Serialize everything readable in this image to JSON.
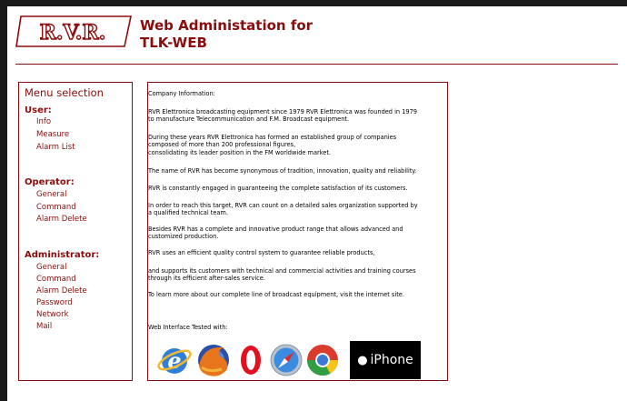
{
  "header": {
    "logo_text": "R.V.R.",
    "title_line1": "Web Administation for",
    "title_line2": "TLK-WEB"
  },
  "sidebar": {
    "title": "Menu selection",
    "sections": [
      {
        "label": "User:",
        "items": [
          "Info",
          "Measure",
          "Alarm List"
        ]
      },
      {
        "label": "Operator:",
        "items": [
          "General",
          "Command",
          "Alarm Delete"
        ]
      },
      {
        "label": "Administrator:",
        "items": [
          "General",
          "Command",
          "Alarm Delete",
          "Password",
          "Network",
          "Mail"
        ]
      }
    ]
  },
  "main": {
    "paragraphs": [
      "Company Information:",
      "RVR Elettronica broadcasting equipment since 1979 RVR Elettronica was founded in 1979\nto manufacture Telecommunication and F.M. Broadcast equipment.",
      "During these years RVR Elettronica has formed an established group of companies\ncomposed of more than 200 professional figures,\nconsolidating its leader position in the FM worldwide market.",
      "The name of RVR has become synonymous of tradition, innovation, quality and reliability.",
      "RVR is constantly engaged in guaranteeing the complete satisfaction of its customers.",
      "In order to reach this target, RVR can count on a detailed sales organization supported by\na qualified technical team.",
      "Besides RVR has a complete and innovative product range that allows advanced and\ncustomized production.",
      "RVR uses an efficient quality control system to guarantee reliable products,",
      "and supports its customers with technical and commercial activities and training courses\nthrough its efficient after-sales service.",
      "To learn more about our complete line of broadcast equipment, visit the internet site.",
      "Web Interface Tested with:"
    ],
    "browsers": [
      "internet-explorer",
      "firefox",
      "opera",
      "safari",
      "chrome"
    ],
    "iphone_label": "iPhone"
  },
  "colors": {
    "accent": "#8b0c0c",
    "frame": "#1a1a1a"
  }
}
